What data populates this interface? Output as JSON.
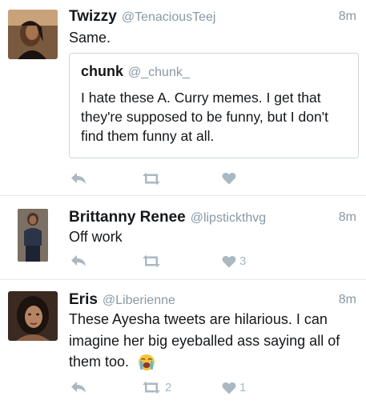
{
  "tweets": [
    {
      "name": "Twizzy",
      "handle": "@TenaciousTeej",
      "time": "8m",
      "text": "Same.",
      "quote": {
        "name": "chunk",
        "handle": "@_chunk_",
        "text": "I hate these A. Curry memes. I get that they're supposed to be funny, but I don't find them funny at all."
      },
      "retweet_count": "",
      "like_count": ""
    },
    {
      "name": "Brittanny Renee",
      "handle": "@lipstickthvg",
      "time": "8m",
      "text": "Off work",
      "retweet_count": "",
      "like_count": "3"
    },
    {
      "name": "Eris",
      "handle": "@Liberienne",
      "time": "8m",
      "text": "These Ayesha tweets are hilarious. I can imagine her big eyeballed ass saying all of them too.",
      "emoji": "loudly-crying-face",
      "retweet_count": "2",
      "like_count": "1"
    }
  ],
  "colors": {
    "icon": "#aab8c2",
    "secondary_text": "#8899a6",
    "divider": "#e1e8ed",
    "quote_border": "#ccd6dd"
  },
  "icons": {
    "reply": "reply-icon",
    "retweet": "retweet-icon",
    "like": "heart-icon"
  }
}
